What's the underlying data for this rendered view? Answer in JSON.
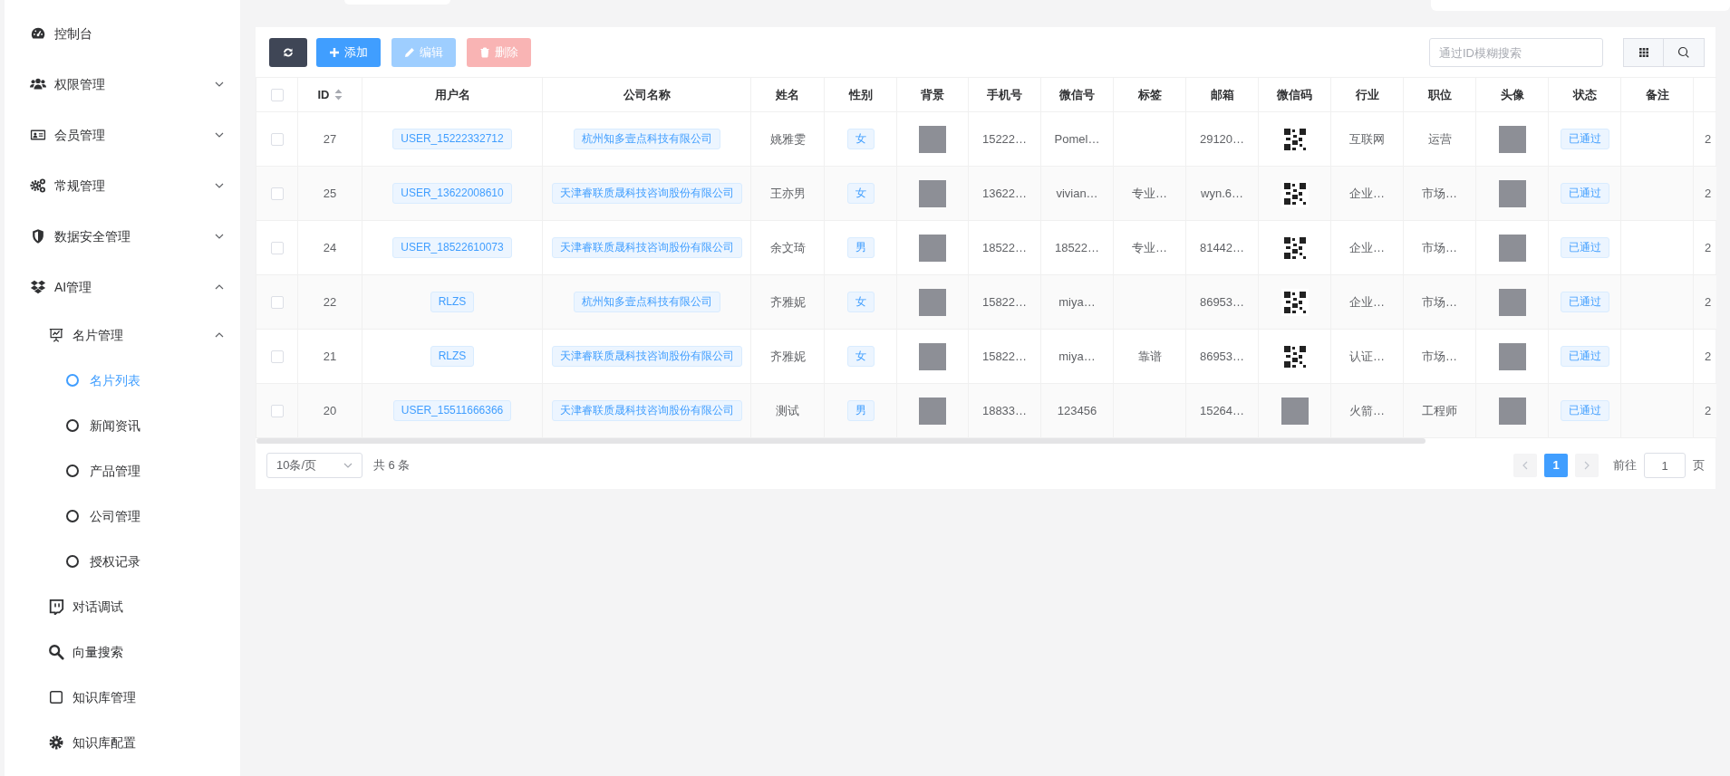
{
  "sidebar": {
    "items": [
      {
        "label": "控制台",
        "selected": false
      },
      {
        "label": "权限管理",
        "selected": false,
        "expanded": false
      },
      {
        "label": "会员管理",
        "selected": false,
        "expanded": false
      },
      {
        "label": "常规管理",
        "selected": false,
        "expanded": false
      },
      {
        "label": "数据安全管理",
        "selected": false,
        "expanded": false
      },
      {
        "label": "AI管理",
        "selected": false,
        "expanded": true,
        "children": [
          {
            "label": "名片管理",
            "selected": false,
            "expanded": true,
            "children": [
              {
                "label": "名片列表",
                "selected": true
              },
              {
                "label": "新闻资讯",
                "selected": false
              },
              {
                "label": "产品管理",
                "selected": false
              },
              {
                "label": "公司管理",
                "selected": false
              },
              {
                "label": "授权记录",
                "selected": false
              }
            ]
          },
          {
            "label": "对话调试",
            "selected": false
          },
          {
            "label": "向量搜索",
            "selected": false
          },
          {
            "label": "知识库管理",
            "selected": false
          },
          {
            "label": "知识库配置",
            "selected": false
          }
        ]
      }
    ]
  },
  "toolbar": {
    "buttons": [
      {
        "kind": "refresh",
        "disabled": false
      },
      {
        "kind": "add",
        "label": "添加",
        "disabled": false
      },
      {
        "kind": "edit",
        "label": "编辑",
        "disabled": true
      },
      {
        "kind": "delete",
        "label": "删除",
        "disabled": true
      }
    ],
    "search": {
      "placeholder": "通过ID模糊搜索"
    }
  },
  "table": {
    "all_selected": false,
    "columns": [
      {
        "label": "ID",
        "sortable": true
      },
      {
        "label": "用户名",
        "sortable": false
      },
      {
        "label": "公司名称",
        "sortable": false
      },
      {
        "label": "姓名",
        "sortable": false
      },
      {
        "label": "性别",
        "sortable": false
      },
      {
        "label": "背景",
        "sortable": false
      },
      {
        "label": "手机号",
        "sortable": false
      },
      {
        "label": "微信号",
        "sortable": false
      },
      {
        "label": "标签",
        "sortable": false
      },
      {
        "label": "邮箱",
        "sortable": false
      },
      {
        "label": "微信码",
        "sortable": false
      },
      {
        "label": "行业",
        "sortable": false
      },
      {
        "label": "职位",
        "sortable": false
      },
      {
        "label": "头像",
        "sortable": false
      },
      {
        "label": "状态",
        "sortable": false
      },
      {
        "label": "备注",
        "sortable": false
      }
    ],
    "rows": [
      {
        "selected": false,
        "id": "27",
        "username": "USER_15222332712",
        "company": "杭州知多壹点科技有限公司",
        "name": "姚雅雯",
        "gender": "女",
        "phone": "15222…",
        "wechat": "Pomel…",
        "email": "29120…",
        "wechat_code": {
          "kind": "qr"
        },
        "industry": "互联网",
        "position": "运营",
        "status": "已通过",
        "column_18": "2"
      },
      {
        "selected": false,
        "id": "25",
        "username": "USER_13622008610",
        "company": "天津睿联质晟科技咨询股份有限公司",
        "name": "王亦男",
        "gender": "女",
        "phone": "13622…",
        "wechat": "vivian…",
        "tag": "专业…",
        "email": "wyn.6…",
        "wechat_code": {
          "kind": "qr"
        },
        "industry": "企业…",
        "position": "市场…",
        "status": "已通过",
        "column_18": "2"
      },
      {
        "selected": false,
        "id": "24",
        "username": "USER_18522610073",
        "company": "天津睿联质晟科技咨询股份有限公司",
        "name": "余文琦",
        "gender": "男",
        "phone": "18522…",
        "wechat": "18522…",
        "tag": "专业…",
        "email": "81442…",
        "wechat_code": {
          "kind": "qr"
        },
        "industry": "企业…",
        "position": "市场…",
        "status": "已通过",
        "column_18": "2"
      },
      {
        "selected": false,
        "id": "22",
        "username": "RLZS",
        "company": "杭州知多壹点科技有限公司",
        "name": "齐雅妮",
        "gender": "女",
        "phone": "15822…",
        "wechat": "miya…",
        "email": "86953…",
        "wechat_code": {
          "kind": "qr"
        },
        "industry": "企业…",
        "position": "市场…",
        "status": "已通过",
        "column_18": "2"
      },
      {
        "selected": false,
        "id": "21",
        "username": "RLZS",
        "company": "天津睿联质晟科技咨询股份有限公司",
        "name": "齐雅妮",
        "gender": "女",
        "phone": "15822…",
        "wechat": "miya…",
        "tag": "靠谱",
        "email": "86953…",
        "wechat_code": {
          "kind": "qr"
        },
        "industry": "认证…",
        "position": "市场…",
        "status": "已通过",
        "column_18": "2"
      },
      {
        "selected": false,
        "id": "20",
        "username": "USER_15511666366",
        "company": "天津睿联质晟科技咨询股份有限公司",
        "name": "测试",
        "gender": "男",
        "phone": "18833…",
        "wechat": "123456",
        "email": "15264…",
        "wechat_code": {
          "kind": "photo"
        },
        "industry": "火箭…",
        "position": "工程师",
        "status": "已通过",
        "column_18": "2"
      }
    ]
  },
  "pagination": {
    "page_size": "10条/页",
    "total": "共 6 条",
    "prev_disabled": true,
    "next_disabled": true,
    "pages": [
      {
        "label": "1",
        "selected": true
      }
    ],
    "goto_label": "前往",
    "goto_value": "1",
    "page_suffix": "页"
  }
}
